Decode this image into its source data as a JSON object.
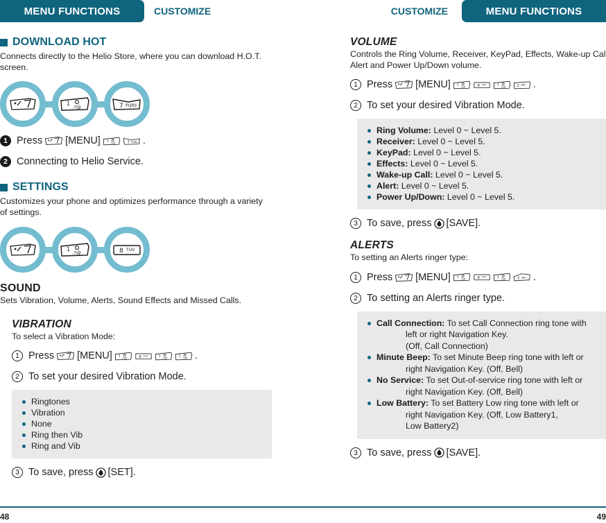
{
  "header": {
    "left_tab": "MENU FUNCTIONS",
    "left_plain": "CUSTOMIZE",
    "right_plain": "CUSTOMIZE",
    "right_tab": "MENU FUNCTIONS"
  },
  "colors": {
    "teal": "#0f647e",
    "ring": "#74bcd0",
    "graybox": "#e9e9e9",
    "text": "#221f1f"
  },
  "left": {
    "download_hot": {
      "title": "DOWNLOAD HOT",
      "body": "Connects directly to the Helio Store, where you can download H.O.T. screen.",
      "chain_keys": [
        "menu-key",
        "key-1",
        "key-7"
      ],
      "steps": [
        {
          "num": "1",
          "style": "filled",
          "pre": "Press",
          "menu": "[MENU]",
          "keys": [
            "key-1",
            "key-7"
          ],
          "suffix": ".",
          "text": ""
        },
        {
          "num": "2",
          "style": "filled",
          "text": "Connecting to Helio Service."
        }
      ]
    },
    "settings": {
      "title": "SETTINGS",
      "body": "Customizes your phone and optimizes performance through a variety of settings.",
      "chain_keys": [
        "menu-key",
        "key-1",
        "key-8"
      ]
    },
    "sound": {
      "title": "SOUND",
      "body": "Sets Vibration, Volume, Alerts, Sound Effects and Missed Calls."
    },
    "vibration": {
      "title": "VIBRATION",
      "body": "To select a Vibration Mode:",
      "step1": {
        "num": "1",
        "pre": "Press",
        "menu": "[MENU]",
        "keys": [
          "key-1",
          "key-8",
          "key-1",
          "key-1"
        ],
        "suffix": "."
      },
      "step2": {
        "num": "2",
        "text": "To set your desired Vibration Mode."
      },
      "options": [
        "Ringtones",
        "Vibration",
        "None",
        "Ring then Vib",
        "Ring and Vib"
      ],
      "step3": {
        "num": "3",
        "pre": "To save, press",
        "label": "[SET]."
      }
    },
    "page_number": "48"
  },
  "right": {
    "volume": {
      "title": "VOLUME",
      "body": "Controls the Ring Volume, Receiver, KeyPad, Effects, Wake-up Call, Alert and Power Up/Down volume.",
      "step1": {
        "num": "1",
        "pre": "Press",
        "menu": "[MENU]",
        "keys": [
          "key-1",
          "key-8",
          "key-1",
          "key-2"
        ],
        "suffix": "."
      },
      "step2": {
        "num": "2",
        "text": "To set your desired Vibration Mode."
      },
      "options": [
        {
          "name": "Ring Volume:",
          "value": "Level 0 ~ Level 5."
        },
        {
          "name": "Receiver:",
          "value": "Level 0 ~ Level 5."
        },
        {
          "name": "KeyPad:",
          "value": "Level 0 ~ Level 5."
        },
        {
          "name": "Effects:",
          "value": "Level 0 ~ Level 5."
        },
        {
          "name": "Wake-up Call:",
          "value": "Level 0 ~ Level 5."
        },
        {
          "name": "Alert:",
          "value": "Level 0 ~ Level 5."
        },
        {
          "name": "Power Up/Down:",
          "value": "Level 0 ~ Level 5."
        }
      ],
      "step3": {
        "num": "3",
        "pre": "To save, press",
        "label": "[SAVE]."
      }
    },
    "alerts": {
      "title": "ALERTS",
      "body": "To setting an Alerts ringer type:",
      "step1": {
        "num": "1",
        "pre": "Press",
        "menu": "[MENU]",
        "keys": [
          "key-1",
          "key-8",
          "key-1",
          "key-3"
        ],
        "suffix": "."
      },
      "step2": {
        "num": "2",
        "text": "To setting an Alerts ringer type."
      },
      "options": [
        {
          "name": "Call Connection:",
          "value": "To set Call Connection ring tone with",
          "lines": [
            "left or right Navigation Key.",
            "(Off, Call Connection)"
          ]
        },
        {
          "name": "Minute Beep:",
          "value": "To set Minute Beep ring tone with left or",
          "lines": [
            "right Navigation Key. (Off, Bell)"
          ]
        },
        {
          "name": "No Service:",
          "value": "To set Out-of-service ring tone with left or",
          "lines": [
            "right Navigation Key. (Off, Bell)"
          ]
        },
        {
          "name": "Low Battery:",
          "value": "To set Battery Low ring tone with left or",
          "lines": [
            "right Navigation Key. (Off, Low Battery1,",
            "Low Battery2)"
          ]
        }
      ],
      "step3": {
        "num": "3",
        "pre": "To save, press",
        "label": "[SAVE]."
      }
    },
    "page_number": "49"
  }
}
